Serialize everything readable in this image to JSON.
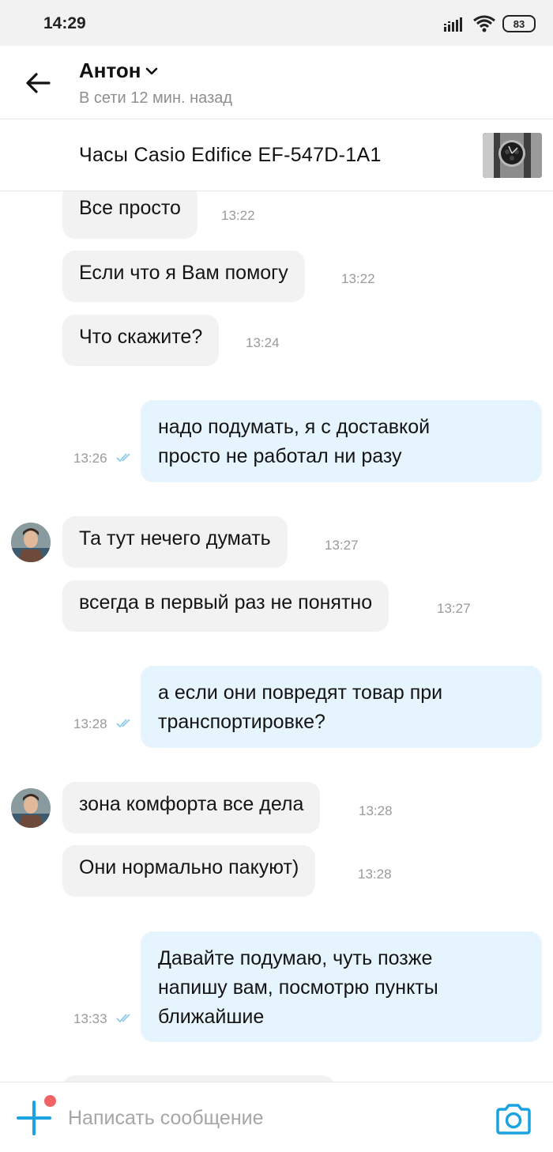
{
  "status_bar": {
    "time": "14:29",
    "battery": "83"
  },
  "header": {
    "contact_name": "Антон",
    "contact_status": "В сети 12 мин. назад"
  },
  "product": {
    "title": "Часы Casio Edifice EF-547D-1A1"
  },
  "messages": [
    {
      "dir": "in",
      "text": "Все просто",
      "time": "13:22"
    },
    {
      "dir": "in",
      "text": "Если что я Вам помогу",
      "time": "13:22"
    },
    {
      "dir": "in",
      "text": "Что скажите?",
      "time": "13:24"
    },
    {
      "dir": "out",
      "lines": [
        "надо подумать, я с доставкой",
        "просто не работал ни разу"
      ],
      "time": "13:26"
    },
    {
      "dir": "in",
      "text": "Та тут нечего думать",
      "time": "13:27"
    },
    {
      "dir": "in",
      "text": "всегда в первый раз не понятно",
      "time": "13:27"
    },
    {
      "dir": "out",
      "lines": [
        "а если они повредят товар при",
        "транспортировке?"
      ],
      "time": "13:28"
    },
    {
      "dir": "in",
      "text": "зона комфорта все дела",
      "time": "13:28"
    },
    {
      "dir": "in",
      "text": "Они нормально пакуют)",
      "time": "13:28"
    },
    {
      "dir": "out",
      "lines": [
        "Давайте подумаю, чуть позже",
        "напишу вам, посмотрю пункты",
        "ближайшие"
      ],
      "time": "13:33"
    }
  ],
  "composer": {
    "placeholder": "Написать сообщение"
  },
  "colors": {
    "accent": "#1aa3e0",
    "outgoing_bubble": "#e6f4fd",
    "incoming_bubble": "#f2f2f2",
    "notification_dot": "#f26464"
  }
}
